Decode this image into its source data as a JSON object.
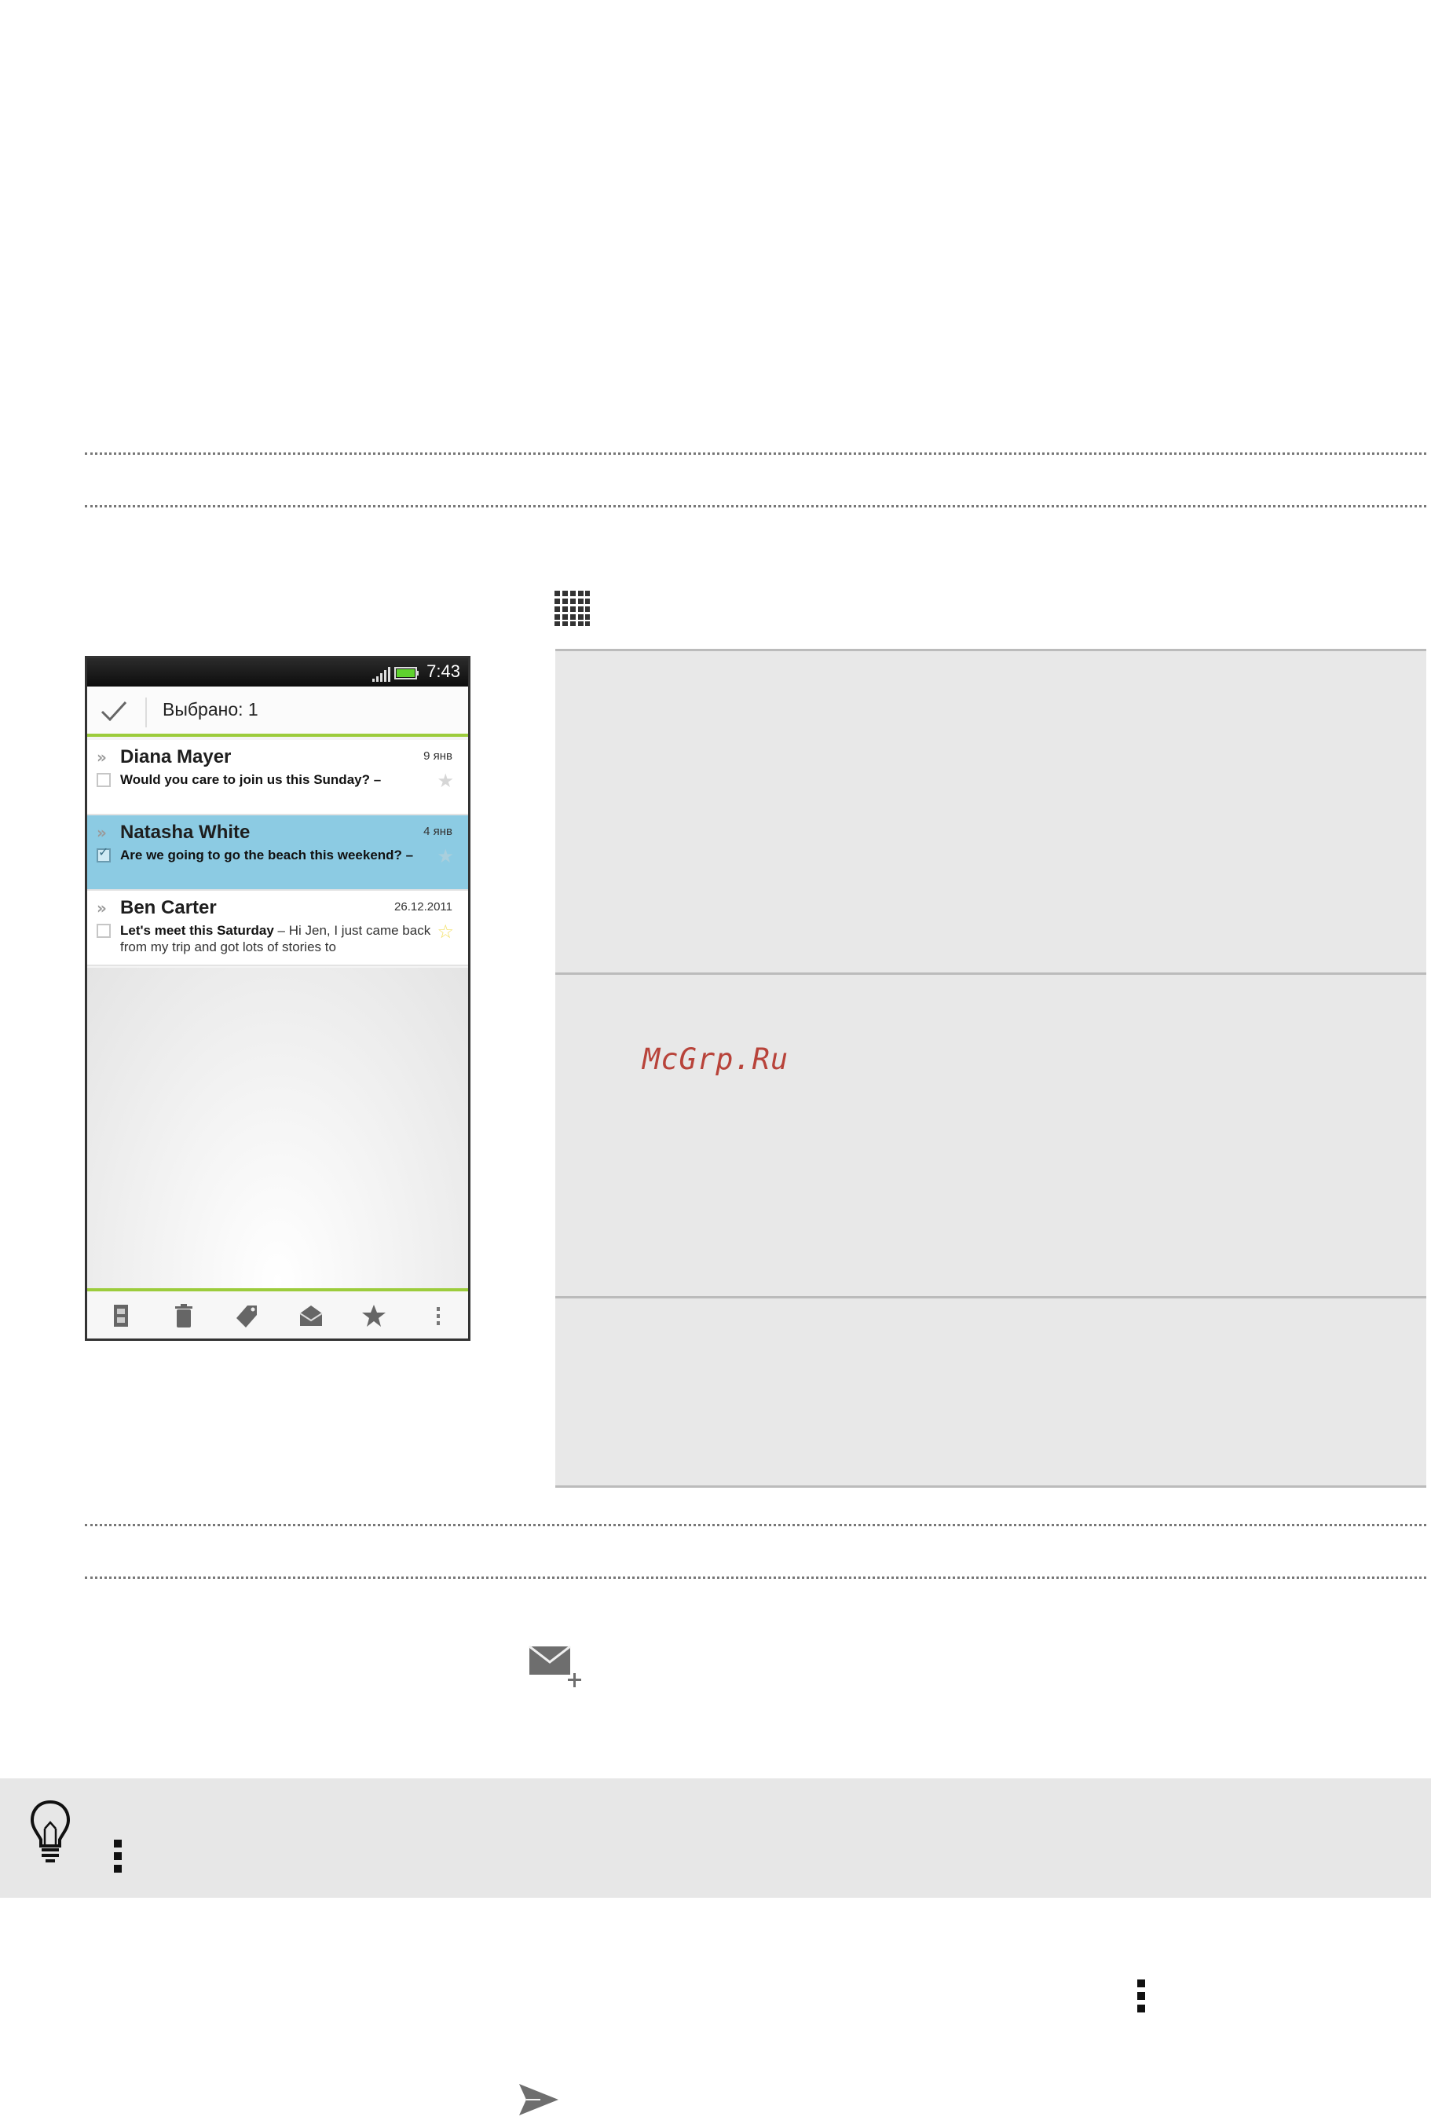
{
  "phone": {
    "status_time": "7:43",
    "action_title": "Выбрано: 1",
    "emails": [
      {
        "name": "Diana Mayer",
        "date": "9 янв",
        "subject": "Would you care to join us this Sunday? –",
        "preview": "",
        "selected": false,
        "starred": false
      },
      {
        "name": "Natasha White",
        "date": "4 янв",
        "subject": "Are we going to go the beach this weekend? –",
        "preview": "",
        "selected": true,
        "starred": false
      },
      {
        "name": "Ben Carter",
        "date": "26.12.2011",
        "subject": "Let's meet this Saturday",
        "preview": " – Hi Jen, I just came back from my trip and got lots of stories to",
        "selected": false,
        "starred": true
      }
    ],
    "bottom_icons": [
      "move-icon",
      "trash-icon",
      "label-icon",
      "mark-read-icon",
      "star-icon",
      "more-icon"
    ]
  },
  "watermark": "McGrp.Ru",
  "icons": {
    "apps_grid": "apps-grid-icon",
    "compose": "compose-mail-icon",
    "tip": "lightbulb-icon",
    "menu": "menu-icon",
    "send": "send-icon"
  },
  "colors": {
    "selected_row": "#8ccbe3",
    "accent_green": "#9ccc3c",
    "tip_background": "#e7e7e7",
    "table_background": "#e8e8e8",
    "watermark": "#b8433a"
  }
}
